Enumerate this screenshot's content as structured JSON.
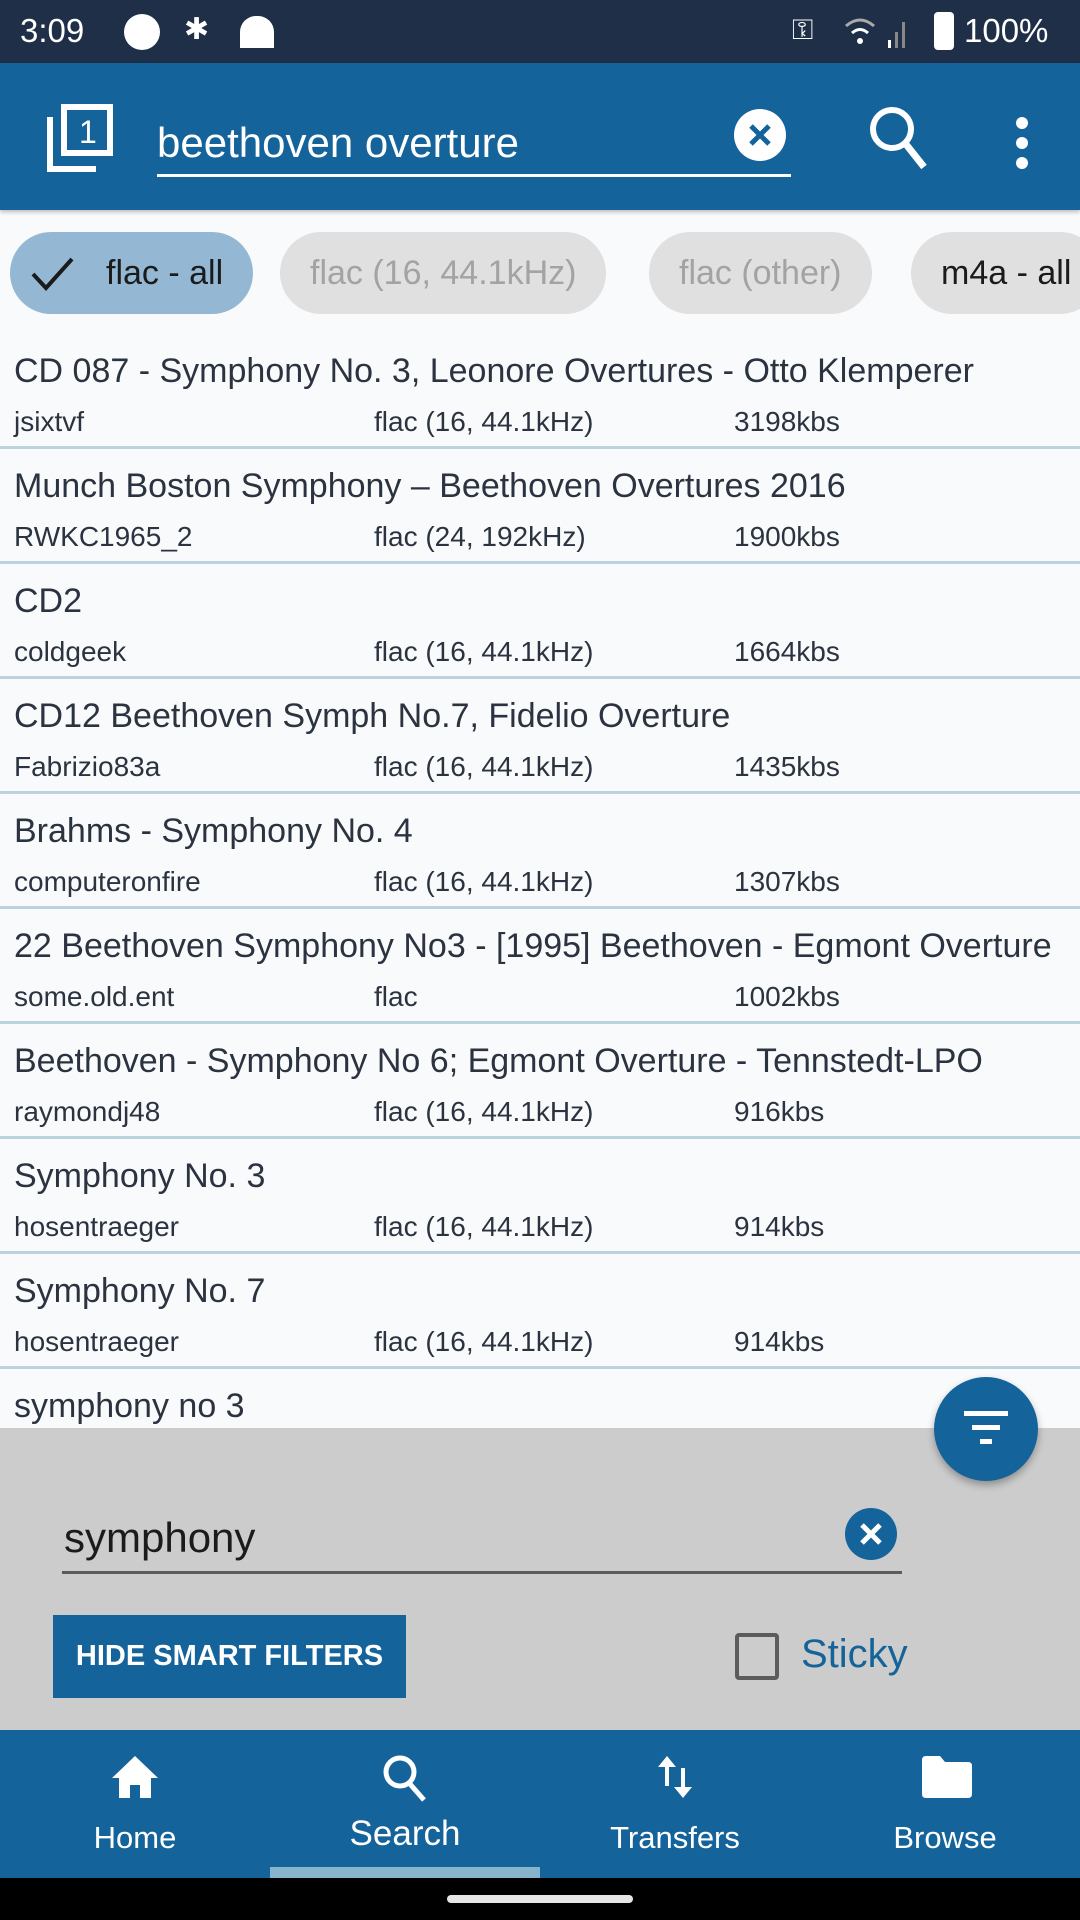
{
  "status_bar": {
    "time": "3:09",
    "battery": "100%"
  },
  "app_bar": {
    "query": "beethoven overture",
    "icons": [
      "tabs-icon",
      "clear-icon",
      "search-icon",
      "more-vert-icon"
    ]
  },
  "chips": [
    {
      "label": "flac - all",
      "selected": true
    },
    {
      "label": "flac (16, 44.1kHz)",
      "selected": false,
      "disabled": true
    },
    {
      "label": "flac (other)",
      "selected": false,
      "disabled": true
    },
    {
      "label": "m4a - all",
      "selected": false
    }
  ],
  "results": [
    {
      "title": "CD 087 - Symphony No. 3, Leonore Overtures - Otto Klemperer",
      "user": "jsixtvf",
      "format": "flac (16, 44.1kHz)",
      "bitrate": "3198kbs"
    },
    {
      "title": "Munch Boston Symphony – Beethoven Overtures 2016",
      "user": "RWKC1965_2",
      "format": "flac (24, 192kHz)",
      "bitrate": "1900kbs"
    },
    {
      "title": "CD2",
      "user": "coldgeek",
      "format": "flac (16, 44.1kHz)",
      "bitrate": "1664kbs"
    },
    {
      "title": "CD12 Beethoven Symph No.7, Fidelio Overture",
      "user": "Fabrizio83a",
      "format": "flac (16, 44.1kHz)",
      "bitrate": "1435kbs"
    },
    {
      "title": "Brahms - Symphony No. 4",
      "user": "computeronfire",
      "format": "flac (16, 44.1kHz)",
      "bitrate": "1307kbs"
    },
    {
      "title": "22 Beethoven Symphony No3 - [1995] Beethoven - Egmont Overture",
      "user": "some.old.ent",
      "format": "flac",
      "bitrate": "1002kbs"
    },
    {
      "title": "Beethoven - Symphony No 6; Egmont Overture - Tennstedt-LPO",
      "user": "raymondj48",
      "format": "flac (16, 44.1kHz)",
      "bitrate": "916kbs"
    },
    {
      "title": "Symphony No. 3",
      "user": "hosentraeger",
      "format": "flac (16, 44.1kHz)",
      "bitrate": "914kbs"
    },
    {
      "title": "Symphony No. 7",
      "user": "hosentraeger",
      "format": "flac (16, 44.1kHz)",
      "bitrate": "914kbs"
    },
    {
      "title": "symphony no 3",
      "user": "",
      "format": "",
      "bitrate": ""
    }
  ],
  "filter_panel": {
    "filter_text": "symphony",
    "hide_button": "HIDE SMART FILTERS",
    "sticky_label": "Sticky",
    "sticky_checked": false
  },
  "nav": [
    {
      "label": "Home",
      "icon": "home-icon"
    },
    {
      "label": "Search",
      "icon": "search-icon",
      "active": true
    },
    {
      "label": "Transfers",
      "icon": "transfers-icon"
    },
    {
      "label": "Browse",
      "icon": "folder-icon"
    }
  ],
  "colors": {
    "primary": "#14639a",
    "status_bar": "#1e2f47",
    "chip_selected": "#94b8d4",
    "panel": "#cccccc"
  }
}
